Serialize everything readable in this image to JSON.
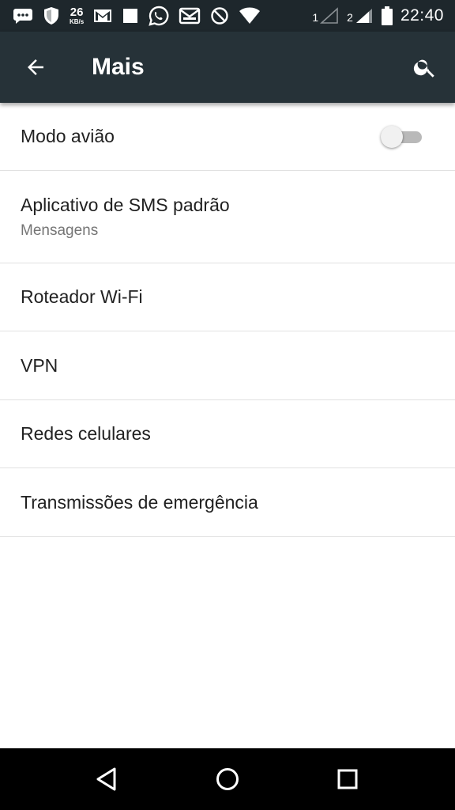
{
  "status_bar": {
    "icons_left": [
      "chat-bubble-icon",
      "shield-icon",
      "gmail-icon",
      "square-notification-icon",
      "whatsapp-icon",
      "mail-icon",
      "do-not-disturb-icon",
      "wifi-icon"
    ],
    "data_speed_value": "26",
    "data_speed_unit": "KB/s",
    "sim1_label": "1",
    "sim2_label": "2",
    "time": "22:40"
  },
  "app_bar": {
    "title": "Mais",
    "back_icon": "arrow-back-icon",
    "search_icon": "search-icon"
  },
  "settings": {
    "items": [
      {
        "title": "Modo avião",
        "toggle": false
      },
      {
        "title": "Aplicativo de SMS padrão",
        "subtitle": "Mensagens"
      },
      {
        "title": "Roteador Wi-Fi"
      },
      {
        "title": "VPN"
      },
      {
        "title": "Redes celulares"
      },
      {
        "title": "Transmissões de emergência"
      }
    ]
  },
  "nav_bar": {
    "buttons": [
      "back-triangle-icon",
      "home-circle-icon",
      "recents-square-icon"
    ]
  },
  "colors": {
    "status_bar_bg": "#1e272c",
    "app_bar_bg": "#263238",
    "divider": "#e1e1e1",
    "primary_text": "#212121",
    "secondary_text": "#757575"
  }
}
